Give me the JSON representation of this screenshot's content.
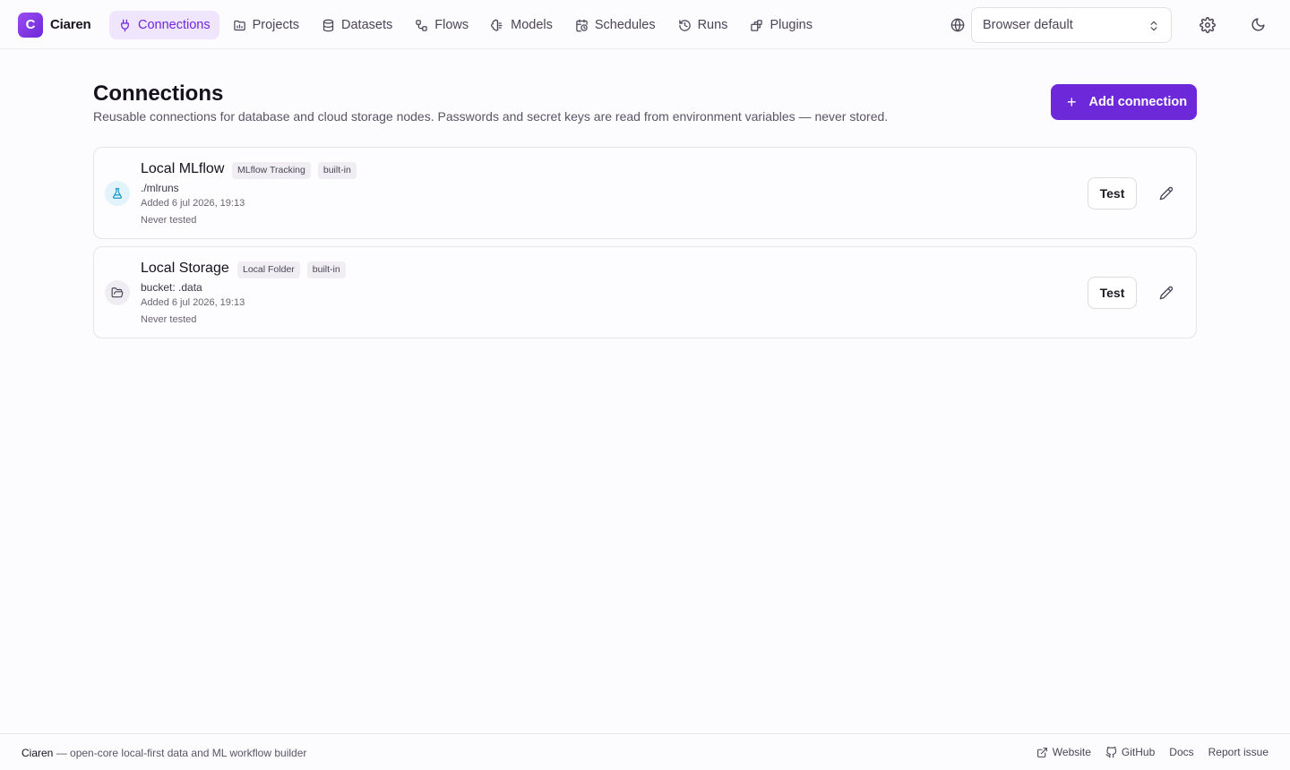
{
  "app": {
    "logo_letter": "C",
    "name": "Ciaren"
  },
  "nav": [
    {
      "label": "Connections",
      "icon": "plug-icon",
      "active": true
    },
    {
      "label": "Projects",
      "icon": "folder-chart-icon",
      "active": false
    },
    {
      "label": "Datasets",
      "icon": "database-icon",
      "active": false
    },
    {
      "label": "Flows",
      "icon": "workflow-icon",
      "active": false
    },
    {
      "label": "Models",
      "icon": "brain-icon",
      "active": false
    },
    {
      "label": "Schedules",
      "icon": "calendar-clock-icon",
      "active": false
    },
    {
      "label": "Runs",
      "icon": "history-icon",
      "active": false
    },
    {
      "label": "Plugins",
      "icon": "puzzle-icon",
      "active": false
    }
  ],
  "header": {
    "language_value": "Browser default"
  },
  "page": {
    "title": "Connections",
    "subtitle": "Reusable connections for database and cloud storage nodes. Passwords and secret keys are read from environment variables — never stored.",
    "add_button": "Add connection"
  },
  "connections": [
    {
      "name": "Local MLflow",
      "type_badge": "MLflow Tracking",
      "builtin_badge": "built-in",
      "path": "./mlruns",
      "added": "Added 6 jul 2026, 19:13",
      "tested": "Never tested",
      "test_label": "Test",
      "icon": "flask-icon"
    },
    {
      "name": "Local Storage",
      "type_badge": "Local Folder",
      "builtin_badge": "built-in",
      "path": "bucket: .data",
      "added": "Added 6 jul 2026, 19:13",
      "tested": "Never tested",
      "test_label": "Test",
      "icon": "folder-open-icon"
    }
  ],
  "footer": {
    "brand": "Ciaren",
    "tagline": " — open-core local-first data and ML workflow builder",
    "links": {
      "website": "Website",
      "github": "GitHub",
      "docs": "Docs",
      "report": "Report issue"
    }
  },
  "colors": {
    "accent": "#6d28d9",
    "accent_light": "#efe6fd"
  }
}
